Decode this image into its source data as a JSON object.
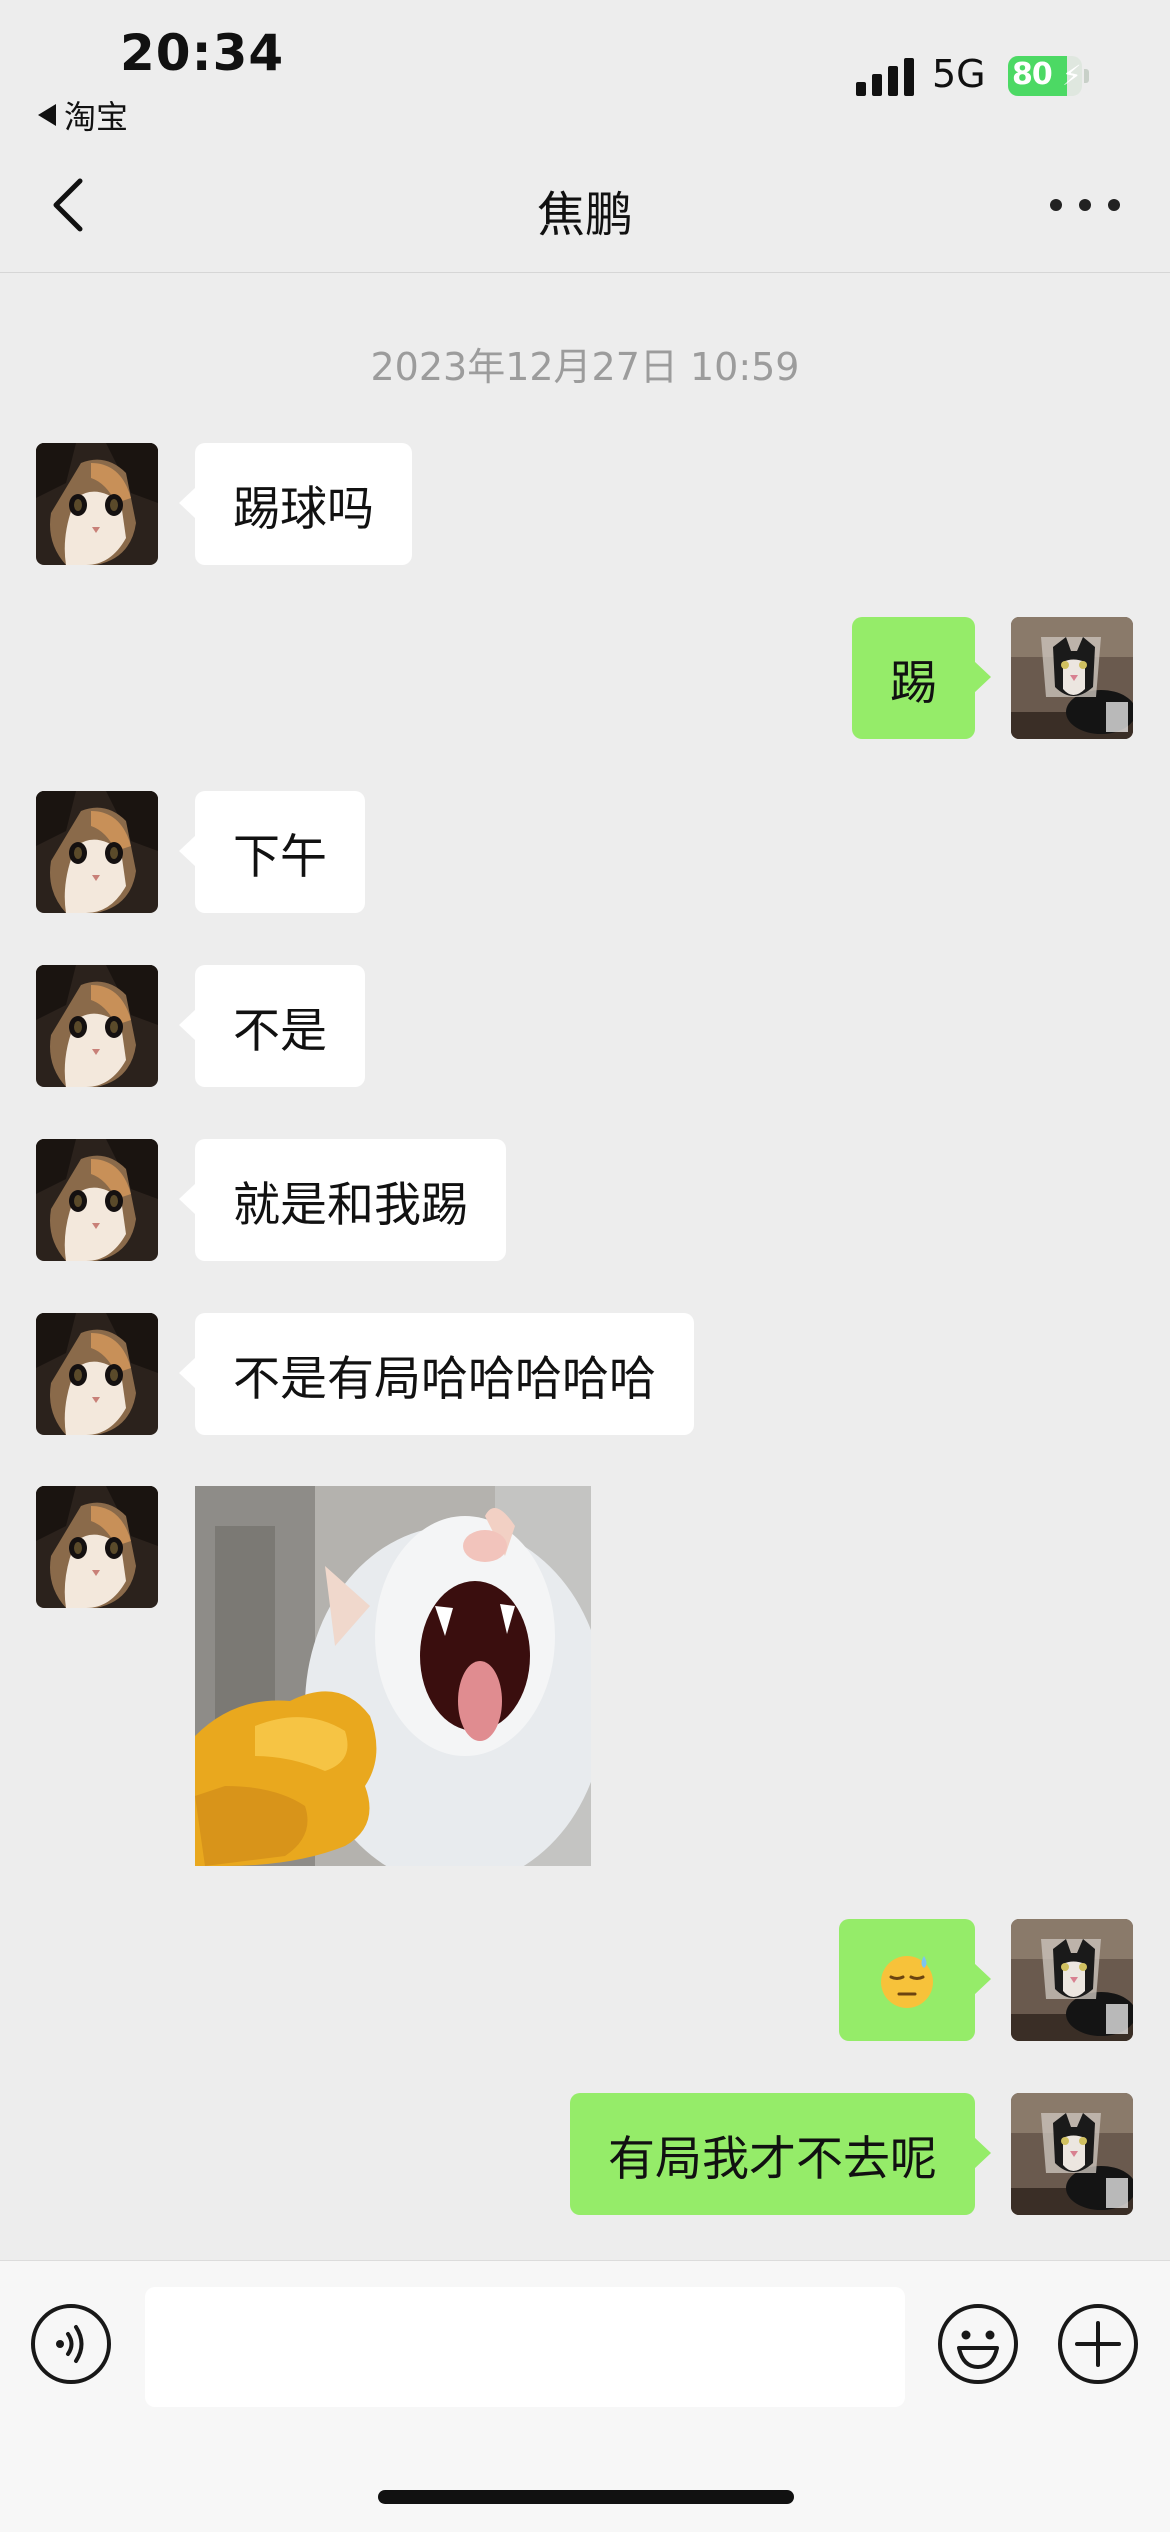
{
  "status": {
    "time": "20:34",
    "back_app": "淘宝",
    "network": "5G",
    "battery": "80",
    "battery_level": 0.8
  },
  "header": {
    "title": "焦鹏"
  },
  "chat": {
    "timestamp": "2023年12月27日 10:59",
    "messages": [
      {
        "side": "in",
        "type": "text",
        "text": "踢球吗"
      },
      {
        "side": "out",
        "type": "text",
        "text": "踢"
      },
      {
        "side": "in",
        "type": "text",
        "text": "下午"
      },
      {
        "side": "in",
        "type": "text",
        "text": "不是"
      },
      {
        "side": "in",
        "type": "text",
        "text": "就是和我踢"
      },
      {
        "side": "in",
        "type": "text",
        "text": "不是有局哈哈哈哈哈"
      },
      {
        "side": "in",
        "type": "sticker",
        "sticker": "screaming-cat-sticker"
      },
      {
        "side": "out",
        "type": "emoji",
        "emoji": "downcast-face-with-sweat"
      },
      {
        "side": "out",
        "type": "text",
        "text": "有局我才不去呢"
      }
    ]
  },
  "input": {
    "value": "",
    "voice_icon": "voice-icon",
    "emoji_icon": "emoji-icon",
    "plus_icon": "plus-icon"
  },
  "colors": {
    "background": "#ededed",
    "outgoing_bubble": "#95ec69",
    "incoming_bubble": "#ffffff",
    "battery": "#4cd964"
  }
}
